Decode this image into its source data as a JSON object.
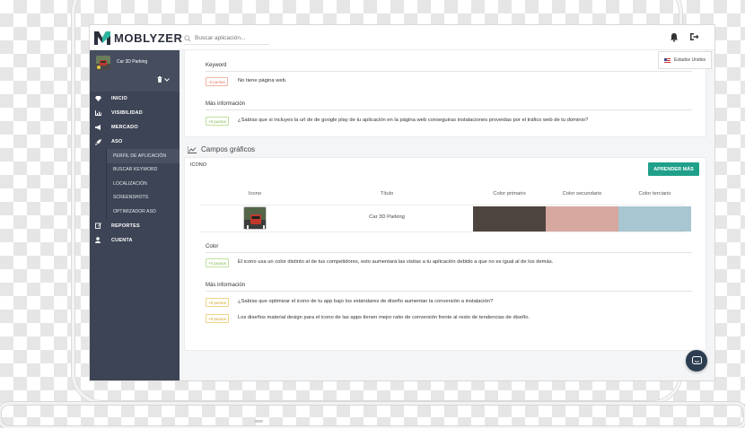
{
  "app": {
    "brand": "MOBLYZER"
  },
  "search": {
    "placeholder": "Buscar aplicación..."
  },
  "header": {
    "language": "Estados Unidos"
  },
  "sidebar": {
    "app_name": "Car 3D Parking",
    "items": [
      {
        "label": "INICIO",
        "icon": "diamond-icon"
      },
      {
        "label": "VISIBILIDAD",
        "icon": "bar-chart-icon"
      },
      {
        "label": "MERCADO",
        "icon": "megaphone-icon"
      },
      {
        "label": "ASO",
        "icon": "rocket-icon"
      }
    ],
    "aso_subitems": [
      {
        "label": "PERFIL DE APLICACIÓN",
        "active": true
      },
      {
        "label": "BUSCAR KEYWORD"
      },
      {
        "label": "LOCALIZACIÓN"
      },
      {
        "label": "SCREENSHOTS"
      },
      {
        "label": "OPTIMIZADOR ASO"
      }
    ],
    "bottom_items": [
      {
        "label": "REPORTES",
        "icon": "edit-icon"
      },
      {
        "label": "CUENTA",
        "icon": "user-icon"
      }
    ]
  },
  "keyword_section": {
    "title": "Keyword",
    "badge": "-3 puntos",
    "text": "No tiene página web."
  },
  "more_info_1": {
    "title": "Más información",
    "badge": "+0 puntos",
    "text": "¿Sabías que si incluyes la url de de google play de tu aplicación en la página web conseguiras instalaciones proveidas por el tráfico web de tu dominio?"
  },
  "graphic_fields": {
    "title": "Campos gráficos",
    "icon_label": "ICONO",
    "learn_more": "APRENDER MÁS",
    "columns": [
      "Icono",
      "Título",
      "Color primario",
      "Color secundario",
      "Color terciario"
    ],
    "row": {
      "title": "Car 3D Parking",
      "colors": [
        "#4d4440",
        "#d6a8a0",
        "#a7c6d1"
      ]
    }
  },
  "color_section": {
    "title": "Color",
    "badge": "+0 puntos",
    "text": "El icono usa un color distinto al de tus competidores, esto aumentará las visitas a tu aplicación debido a que no es igual al de los demás."
  },
  "more_info_2": {
    "title": "Más información",
    "tips": [
      {
        "badge": "+0 puntos",
        "text": "¿Sabías que optimizar el icono de tu app bajo los estándares de diseño aumentan la conversión a instalación?"
      },
      {
        "badge": "+0 puntos",
        "text": "Los diseños material design para el icono de las apps tienen mejor ratio de conversión frente al resto de tendencias de diseño."
      }
    ]
  },
  "colors": {
    "sidebar_bg": "#3d4455",
    "accent": "#20a08a",
    "brand_dark": "#2a2f3c",
    "brand_teal": "#2bb5a0"
  }
}
